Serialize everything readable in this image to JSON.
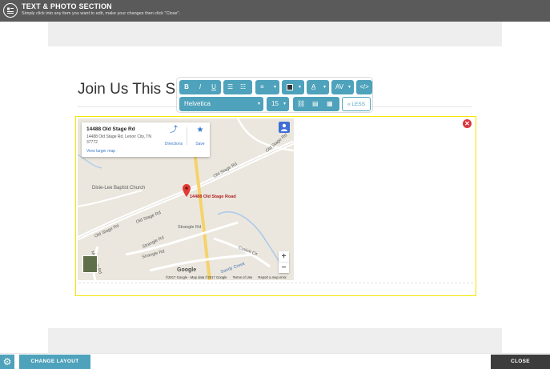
{
  "header": {
    "title": "TEXT & PHOTO SECTION",
    "subtitle": "Simply click into any item you want to edit, make your changes then click \"Close\"."
  },
  "section": {
    "heading": "Join Us This Sun"
  },
  "toolbar": {
    "bold": "B",
    "italic": "I",
    "underline": "U",
    "font": "Helvetica",
    "font_size": "15",
    "less": "LESS"
  },
  "map": {
    "place_name": "14488 Old Stage Rd",
    "address": "14488 Old Stage Rd, Lenoir City, TN 37772",
    "directions": "Directions",
    "save": "Save",
    "view_larger": "View larger map",
    "pin_label": "14488 Old Stage Road",
    "poi": "Dixie-Lee Baptist Church",
    "streets": [
      "Old Stage Rd",
      "Old Stage Rd",
      "Old Stage Rd",
      "Old Stage Rd",
      "Strangle Rd",
      "Strangle Rd",
      "Strangle Rd",
      "Cusick Cir",
      "Mulberry Rd",
      "Sandy Creek"
    ],
    "google": "Google",
    "footer": [
      "©2017 Google - Map data ©2017 Google",
      "Terms of Use",
      "Report a map error"
    ],
    "zoom_in": "+",
    "zoom_out": "−"
  },
  "bottom": {
    "change_layout": "CHANGE LAYOUT",
    "close": "CLOSE"
  },
  "colors": {
    "accent": "#4ea2bb",
    "header": "#5a5a5a",
    "edit_border": "#f3e600",
    "delete": "#d9363e"
  }
}
